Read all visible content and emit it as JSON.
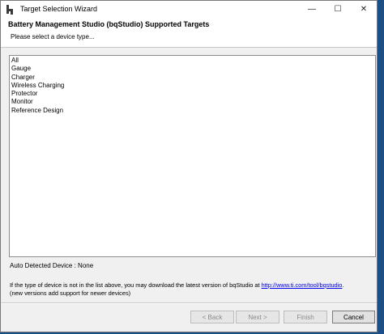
{
  "window": {
    "title": "Target Selection Wizard",
    "icon": "bq-icon",
    "controls": {
      "minimize": "—",
      "maximize": "☐",
      "close": "✕"
    }
  },
  "header": {
    "title": "Battery Management Studio (bqStudio) Supported Targets",
    "subtitle": "Please select a device type..."
  },
  "device_list": [
    "All",
    "Gauge",
    "Charger",
    "Wireless Charging",
    "Protector",
    "Monitor",
    "Reference Design"
  ],
  "status": {
    "detected": "Auto Detected Device : None"
  },
  "info": {
    "line1_prefix": "If the type of device is not in the list above, you may download the latest version of bqStudio at ",
    "link": "http://www.ti.com/tool/bqstudio",
    "line1_suffix": ".",
    "line2": "(new versions add support for newer devices)"
  },
  "buttons": {
    "back": "< Back",
    "next": "Next >",
    "finish": "Finish",
    "cancel": "Cancel"
  },
  "colors": {
    "link": "#0000ee",
    "disabled_text": "#8a8a8a"
  }
}
